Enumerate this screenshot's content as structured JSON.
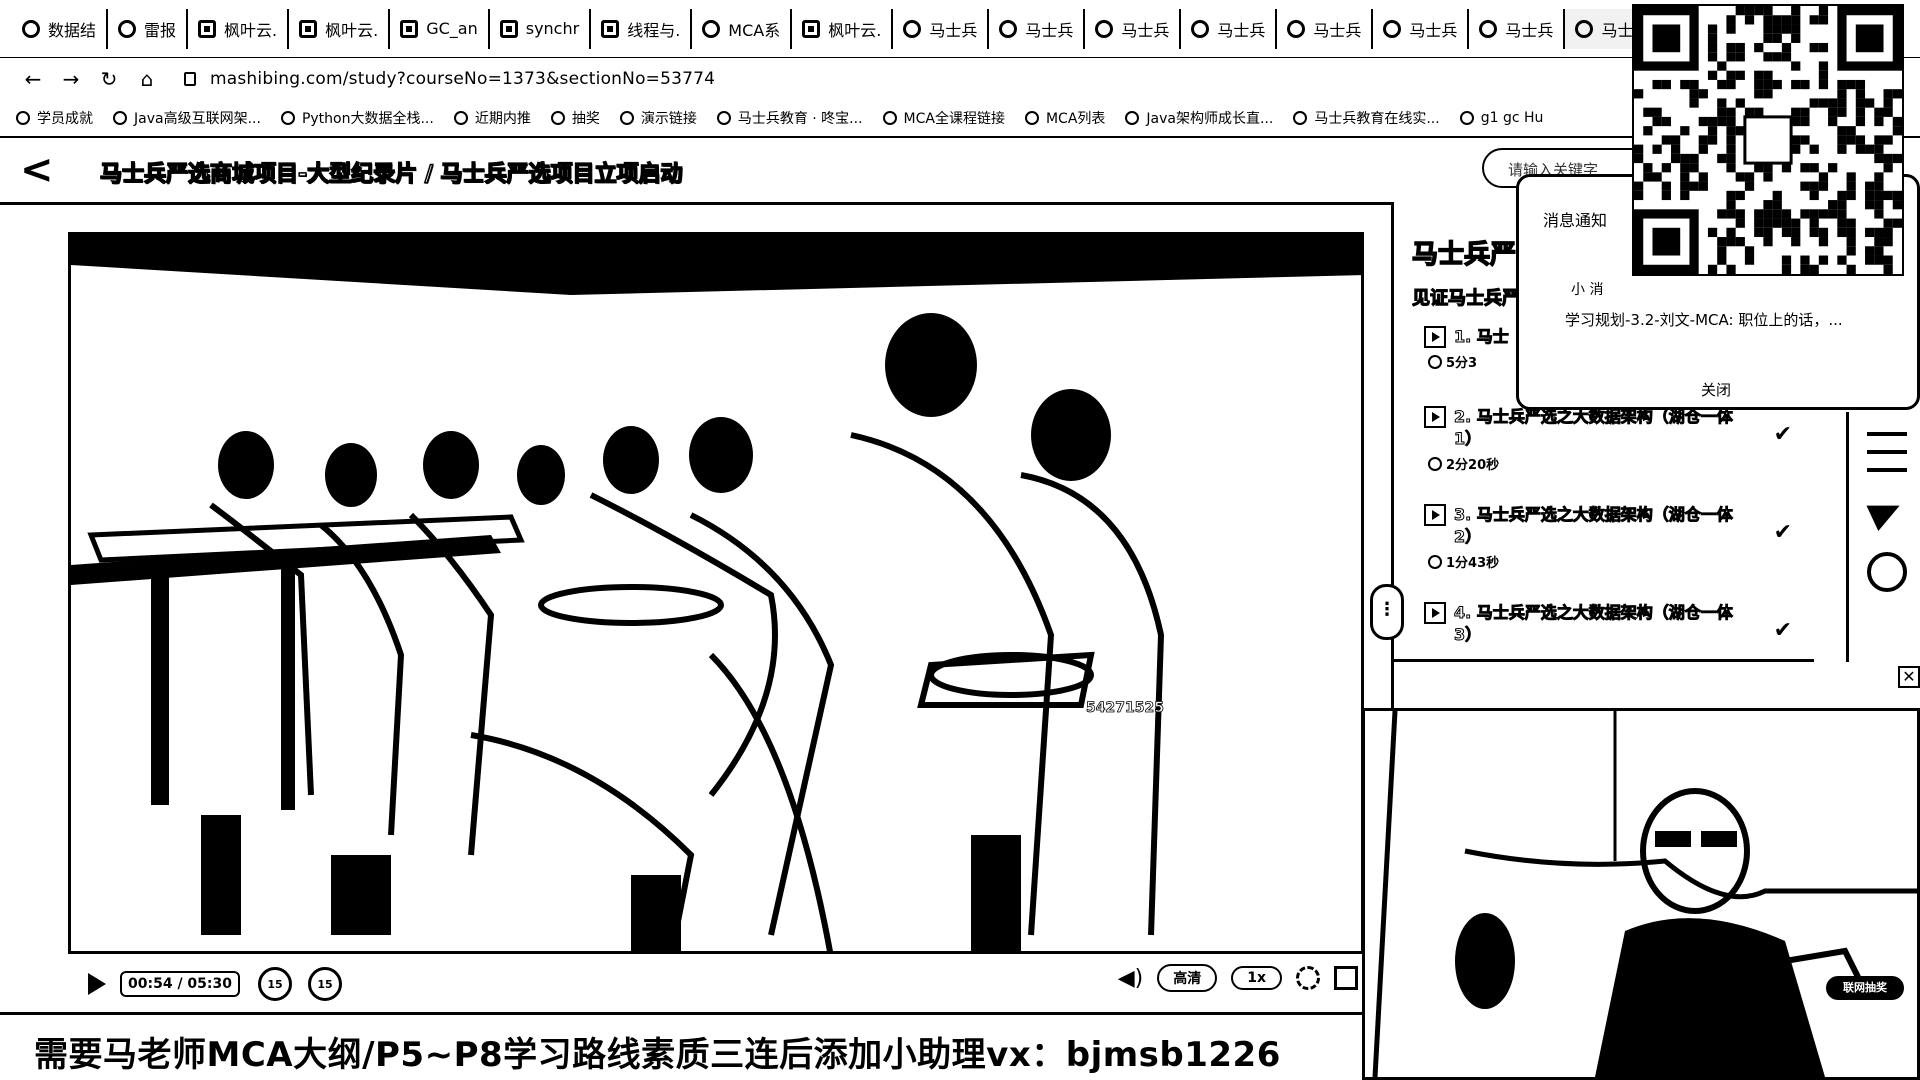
{
  "browser": {
    "tabs": [
      {
        "label": "数据结",
        "icon": "chrome-circle-icon"
      },
      {
        "label": "雷报",
        "icon": "arrow-icon"
      },
      {
        "label": "枫叶云.",
        "icon": "square-icon"
      },
      {
        "label": "枫叶云.",
        "icon": "square-icon"
      },
      {
        "label": "GC_an",
        "icon": "square-icon"
      },
      {
        "label": "synchr",
        "icon": "square-icon"
      },
      {
        "label": "线程与.",
        "icon": "square-icon"
      },
      {
        "label": "MCA系",
        "icon": "chrome-circle-icon"
      },
      {
        "label": "枫叶云.",
        "icon": "square-icon"
      },
      {
        "label": "马士兵",
        "icon": "chrome-circle-icon"
      },
      {
        "label": "马士兵",
        "icon": "loading-icon"
      },
      {
        "label": "马士兵",
        "icon": "chrome-circle-icon"
      },
      {
        "label": "马士兵",
        "icon": "chrome-circle-icon"
      },
      {
        "label": "马士兵",
        "icon": "chrome-circle-icon"
      },
      {
        "label": "马士兵",
        "icon": "loading-icon"
      },
      {
        "label": "马士兵",
        "icon": "chrome-circle-icon"
      },
      {
        "label": "马士",
        "icon": "chrome-circle-icon",
        "active": true,
        "close": "×"
      }
    ],
    "url": "mashibing.com/study?courseNo=1373&sectionNo=53774",
    "bookmarks": [
      "学员成就",
      "Java高级互联网架...",
      "Python大数据全栈...",
      "近期内推",
      "抽奖",
      "演示链接",
      "马士兵教育 · 咚宝...",
      "MCA全课程链接",
      "MCA列表",
      "Java架构师成长直...",
      "马士兵教育在线实...",
      "g1 gc Hu"
    ]
  },
  "header": {
    "back": "<",
    "title": "马士兵严选商城项目-大型纪录片 / 马士兵严选项目立项启动",
    "search_placeholder": "请输入关键字"
  },
  "player": {
    "time": "00:54 / 05:30",
    "rewind": "15",
    "forward": "15",
    "quality": "高清",
    "speed": "1x",
    "watermark": "54271525"
  },
  "banner": "需要马老师MCA大纲/P5~P8学习路线素质三连后添加小助理vx：bjmsb1226",
  "playlist": {
    "title": "马士兵严",
    "subtitle": "见证马士兵严",
    "items": [
      {
        "name": "1. 马士",
        "duration": "5分3",
        "playing": true
      },
      {
        "name": "2. 马士兵严选之大数据架构（湖仓一体1）",
        "duration": "2分20秒"
      },
      {
        "name": "3. 马士兵严选之大数据架构（湖仓一体2）",
        "duration": "1分43秒"
      },
      {
        "name": "4. 马士兵严选之大数据架构（湖仓一体3）",
        "duration": ""
      }
    ],
    "check": "✔"
  },
  "notification": {
    "title": "消息通知",
    "sender": "小 消",
    "message": "学习规划-3.2-刘文-MCA: 职位上的话，...",
    "close": "关闭"
  },
  "pip": {
    "close": "✕",
    "badge": "联网抽奖"
  }
}
